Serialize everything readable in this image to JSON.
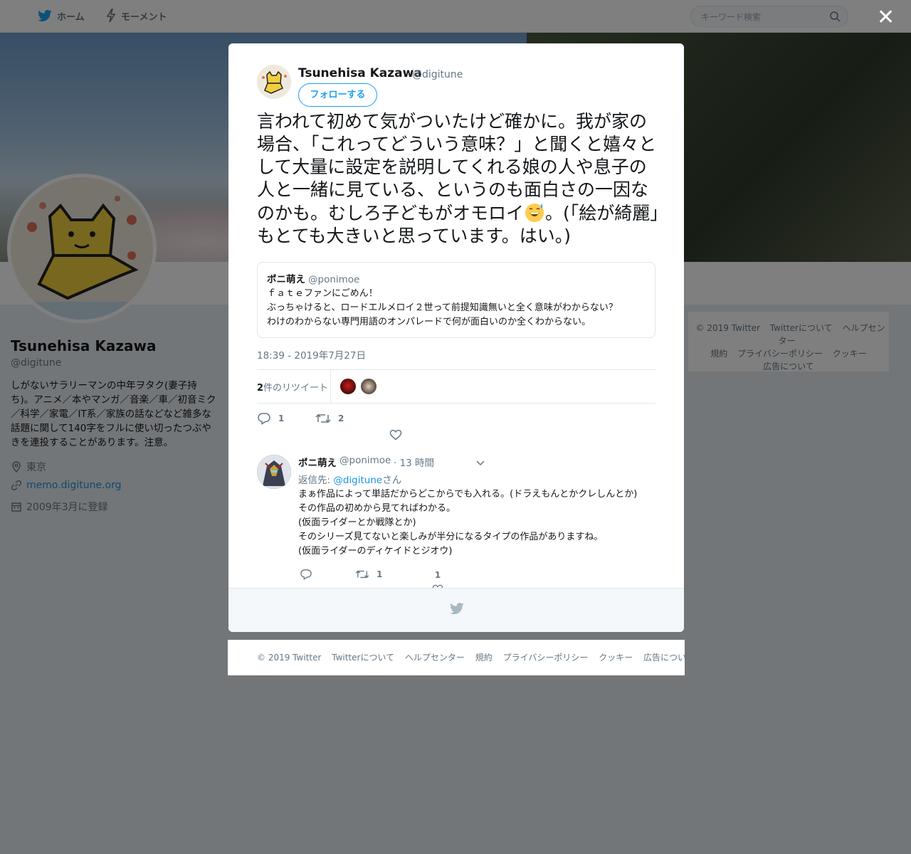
{
  "nav": {
    "home_label": "ホーム",
    "moments_label": "モーメント",
    "search_placeholder": "キーワード検索"
  },
  "profile": {
    "name": "Tsunehisa Kazawa",
    "handle": "@digitune",
    "bio": "しがないサラリーマンの中年ヲタク(妻子持ち)。アニメ／本やマンガ／音楽／車／初音ミク／科学／家電／IT系／家族の話などなど雑多な話題に関して140字をフルに使い切ったつぶやきを連投することがあります。注意。",
    "location": "東京",
    "url": "memo.digitune.org",
    "joined": "2009年3月に登録"
  },
  "side_footer": {
    "links": [
      "© 2019 Twitter",
      "Twitterについて",
      "ヘルプセンター",
      "規約",
      "プライバシーポリシー",
      "クッキー",
      "広告について"
    ]
  },
  "tweet": {
    "author_name": "Tsunehisa Kazawa",
    "author_handle": "@digitune",
    "follow_label": "フォローする",
    "text_before_emoji": "言われて初めて気がついたけど確かに。我が家の場合、「これってどういう意味？」と聞くと嬉々として大量に設定を説明してくれる娘の人や息子の人と一緒に見ている、というのも面白さの一因なのかも。むしろ子どもがオモロイ",
    "emoji": "grinning-sweat-emoji",
    "text_after_emoji": "。(「絵が綺麗」もとても大きいと思っています。はい。)",
    "timestamp": "18:39 - 2019年7月27日",
    "retweet_count_number": "2",
    "retweet_count_suffix": "件のリツイート",
    "reply_count": "1",
    "retweet_count": "2"
  },
  "quote": {
    "name": "ポニ萌え",
    "handle": "@ponimoe",
    "lines": [
      "ｆａｔｅファンにごめん！",
      "ぶっちゃけると、ロードエルメロイ２世って前提知識無いと全く意味がわからない？",
      "わけのわからない専門用語のオンパレードで何が面白いのか全くわからない。"
    ]
  },
  "reply": {
    "name": "ポニ萌え",
    "handle": "@ponimoe",
    "time": "· 13 時間",
    "reply_to_prefix": "返信先: ",
    "reply_to_handle": "@digitune",
    "reply_to_suffix": "さん",
    "lines": [
      "まぁ作品によって単話だからどこからでも入れる。(ドラえもんとかクレしんとか)",
      "その作品の初めから見てればわかる。",
      "(仮面ライダーとか戦隊とか)",
      "そのシリーズ見てないと楽しみが半分になるタイプの作品がありますね。",
      "(仮面ライダーのディケイドとジオウ)"
    ],
    "retweet_count": "1",
    "like_count": "1"
  },
  "bottom_footer": {
    "links": [
      "© 2019 Twitter",
      "Twitterについて",
      "ヘルプセンター",
      "規約",
      "プライバシーポリシー",
      "クッキー",
      "広告について"
    ]
  },
  "colors": {
    "accent": "#1da1f2",
    "link": "#1b95e0",
    "muted": "#657786"
  }
}
